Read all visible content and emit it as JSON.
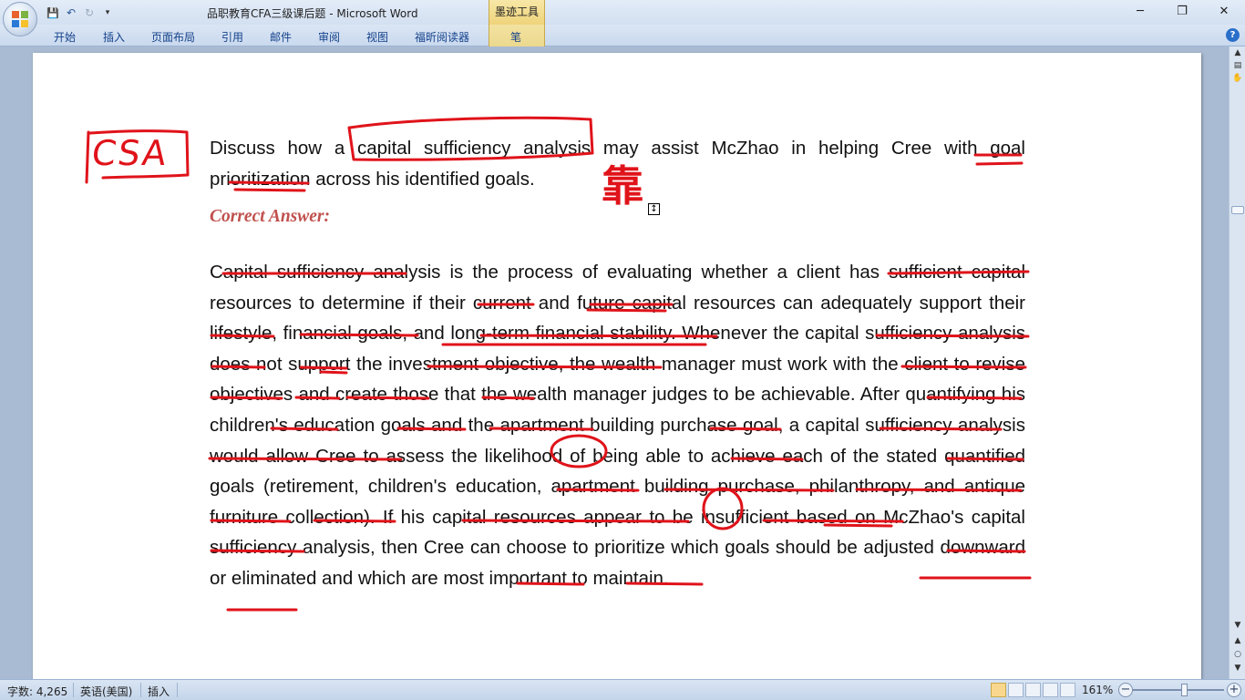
{
  "window": {
    "title": "品职教育CFA三级课后题 - Microsoft Word",
    "context_tab_group": "墨迹工具",
    "controls": {
      "minimize": "─",
      "restore": "❐",
      "close": "✕"
    }
  },
  "quick_access": {
    "save": "💾",
    "undo": "↶",
    "redo": "↻",
    "more": "▾"
  },
  "ribbon": {
    "tabs": [
      "开始",
      "插入",
      "页面布局",
      "引用",
      "邮件",
      "审阅",
      "视图",
      "福昕阅读器",
      "笔"
    ],
    "help": "?"
  },
  "document": {
    "question": "Discuss how a capital sufficiency analysis may assist McZhao in helping Cree with goal prioritization across his identified goals.",
    "answer_label": "Correct Answer:",
    "answer": "Capital sufficiency analysis is the process of evaluating whether a client has sufficient capital resources to determine if their current and future capital resources can adequately support their lifestyle, financial goals, and long-term financial stability. Whenever the capital sufficiency analysis does not support the investment objective, the wealth manager must work with the client to revise objectives and create those that the wealth manager judges to be achievable. After quantifying his children's education goals and the apartment building purchase goal, a capital sufficiency analysis would allow Cree to assess the likelihood of being able to achieve each of the stated quantified goals (retirement, children's education, apartment building purchase, philanthropy, and antique furniture collection). If his capital resources appear to be insufficient based on McZhao's capital sufficiency analysis, then Cree can choose to prioritize which goals should be adjusted downward or eliminated and which are most important to maintain."
  },
  "annotations": {
    "margin_note": "CSA",
    "ink_chinese": "靠",
    "ink_color": "#e0131a"
  },
  "statusbar": {
    "word_count": "字数: 4,265",
    "language": "英语(美国)",
    "mode": "插入",
    "zoom": "161%"
  },
  "colors": {
    "answer_label": "#c0504d",
    "ribbon_text": "#15428b"
  }
}
